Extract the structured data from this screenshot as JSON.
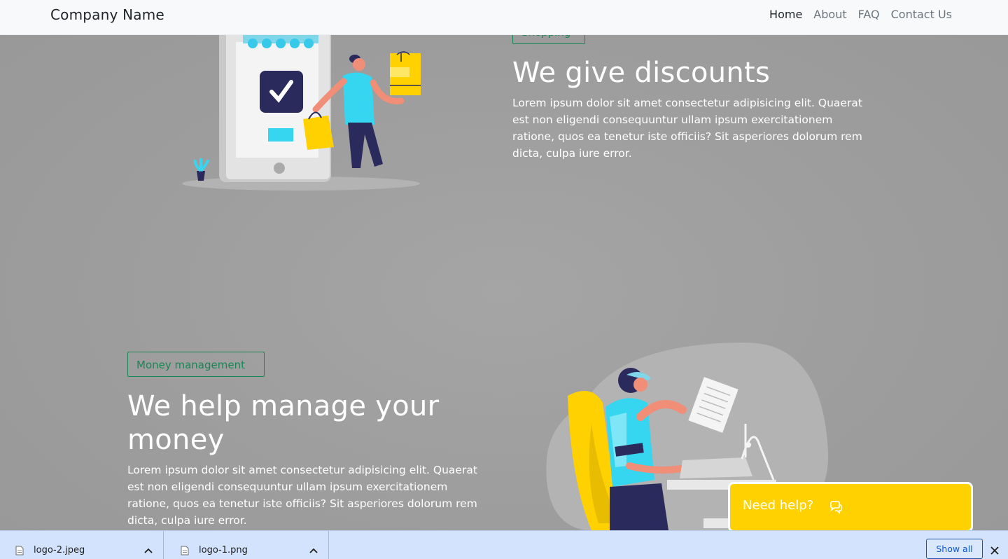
{
  "navbar": {
    "brand": "Company Name",
    "links": [
      {
        "label": "Home",
        "active": true
      },
      {
        "label": "About",
        "active": false
      },
      {
        "label": "FAQ",
        "active": false
      },
      {
        "label": "Contact Us",
        "active": false
      }
    ]
  },
  "sections": [
    {
      "badge": "Shopping",
      "title": "We give discounts",
      "body": "Lorem ipsum dolor sit amet consectetur adipisicing elit. Quaerat est non eligendi consequuntur ullam ipsum exercitationem ratione, quos ea tenetur iste officiis? Sit asperiores dolorum rem dicta, culpa iure error."
    },
    {
      "badge": "Money management",
      "title": "We help manage your money",
      "body": "Lorem ipsum dolor sit amet consectetur adipisicing elit. Quaerat est non eligendi consequuntur ullam ipsum exercitationem ratione, quos ea tenetur iste officiis? Sit asperiores dolorum rem dicta, culpa iure error."
    }
  ],
  "help_widget": {
    "label": "Need help?",
    "icon": "chat-bubbles-icon",
    "color": "#ffd100"
  },
  "download_bar": {
    "items": [
      {
        "name": "logo-2.jpeg",
        "icon": "file-icon"
      },
      {
        "name": "logo-1.png",
        "icon": "file-icon"
      }
    ],
    "show_all_label": "Show all",
    "close_icon": "close-icon"
  },
  "colors": {
    "badge_green": "#198754",
    "overlay_gray": "#9b9b9b",
    "download_bar_bg": "#d3e3fd"
  }
}
